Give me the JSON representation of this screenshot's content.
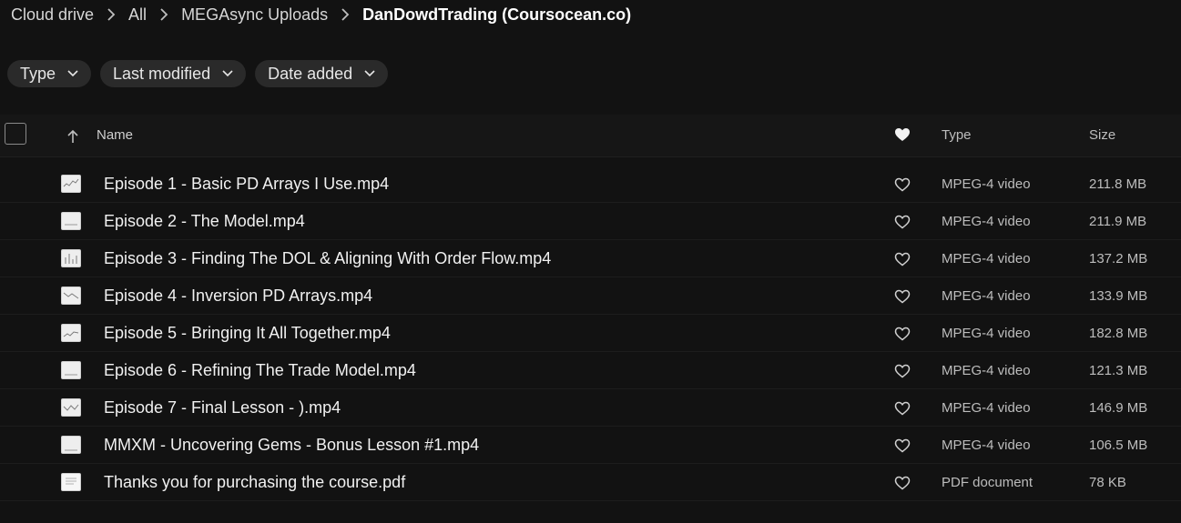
{
  "breadcrumb": [
    {
      "label": "Cloud drive"
    },
    {
      "label": "All"
    },
    {
      "label": "MEGAsync Uploads"
    },
    {
      "label": "DanDowdTrading (Coursocean.co)"
    }
  ],
  "filters": [
    {
      "label": "Type"
    },
    {
      "label": "Last modified"
    },
    {
      "label": "Date added"
    }
  ],
  "table": {
    "columns": {
      "name": "Name",
      "type": "Type",
      "size": "Size"
    },
    "rows": [
      {
        "name": "Episode 1 - Basic PD Arrays I Use.mp4",
        "type": "MPEG-4 video",
        "size": "211.8 MB",
        "thumb": "video"
      },
      {
        "name": "Episode 2 - The Model.mp4",
        "type": "MPEG-4 video",
        "size": "211.9 MB",
        "thumb": "video"
      },
      {
        "name": "Episode 3 - Finding The DOL & Aligning With Order Flow.mp4",
        "type": "MPEG-4 video",
        "size": "137.2 MB",
        "thumb": "video"
      },
      {
        "name": "Episode 4 - Inversion PD Arrays.mp4",
        "type": "MPEG-4 video",
        "size": "133.9 MB",
        "thumb": "video"
      },
      {
        "name": "Episode 5 - Bringing It All Together.mp4",
        "type": "MPEG-4 video",
        "size": "182.8 MB",
        "thumb": "video"
      },
      {
        "name": "Episode 6 - Refining The Trade Model.mp4",
        "type": "MPEG-4 video",
        "size": "121.3 MB",
        "thumb": "video"
      },
      {
        "name": "Episode 7 - Final Lesson - ).mp4",
        "type": "MPEG-4 video",
        "size": "146.9 MB",
        "thumb": "video"
      },
      {
        "name": "MMXM - Uncovering Gems - Bonus Lesson #1.mp4",
        "type": "MPEG-4 video",
        "size": "106.5 MB",
        "thumb": "video"
      },
      {
        "name": "Thanks you for purchasing the course.pdf",
        "type": "PDF document",
        "size": "78 KB",
        "thumb": "pdf"
      }
    ]
  },
  "icons": {
    "chevron": "chevron-right-icon",
    "dropdown": "chevron-down-icon",
    "sort": "arrow-up-icon",
    "favorite": "heart-icon"
  },
  "colors": {
    "background": "#121212",
    "chip": "#2a2a2a",
    "text": "#f1f1f1",
    "muted": "#bdbdbd"
  }
}
